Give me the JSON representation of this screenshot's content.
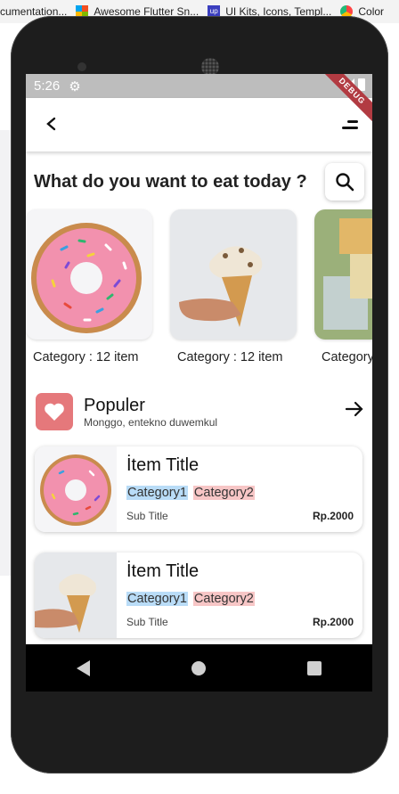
{
  "browser": {
    "bookmarks": [
      {
        "label": "cumentation..."
      },
      {
        "label": "Awesome Flutter Sn..."
      },
      {
        "label": "UI Kits, Icons, Templ..."
      },
      {
        "label": "Color"
      }
    ]
  },
  "status": {
    "time": "5:26",
    "debug_label": "DEBUG"
  },
  "header": {
    "question": "What do you want to eat today ?"
  },
  "categories": [
    {
      "label": "Category : 12 item",
      "image": "donut"
    },
    {
      "label": "Category : 12 item",
      "image": "ice-cream-cone"
    },
    {
      "label": "Category",
      "image": "dessert-glass"
    }
  ],
  "popular": {
    "title": "Populer",
    "subtitle": "Monggo, entekno duwemkul"
  },
  "items": [
    {
      "title": "İtem Title",
      "tag1": "Category1",
      "tag2": "Category2",
      "subtitle": "Sub Title",
      "price": "Rp.2000",
      "image": "donut"
    },
    {
      "title": "İtem Title",
      "tag1": "Category1",
      "tag2": "Category2",
      "subtitle": "Sub Title",
      "price": "Rp.2000",
      "image": "ice-cream-cone"
    }
  ],
  "colors": {
    "accent": "#e5787b",
    "tag_blue": "#b9dcf7",
    "tag_pink": "#f7c6c6"
  }
}
